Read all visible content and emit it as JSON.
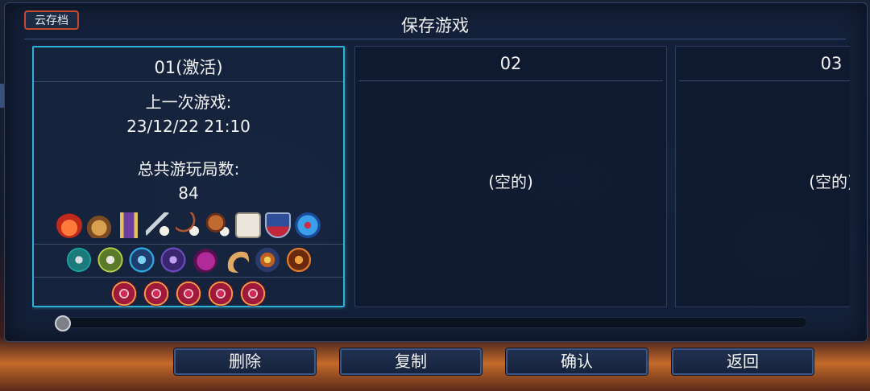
{
  "header": {
    "cloud_save_label": "云存档",
    "title": "保存游戏"
  },
  "slots": [
    {
      "title": "01(激活)",
      "active": true,
      "last_played_label": "上一次游戏:",
      "last_played_value": "23/12/22 21:10",
      "total_runs_label": "总共游玩局数:",
      "total_runs_value": "84",
      "icon_rows": [
        [
          "fire-flask-icon",
          "gold-pouch-icon",
          "stat-scroll-icon",
          "sword-dice-icon",
          "bow-dice-icon",
          "shield-dice-icon",
          "white-dice-icon",
          "heater-shield-icon",
          "blue-orb-icon"
        ],
        [
          "trophy-rune-icon",
          "wrench-rune-icon",
          "grapple-rune-icon",
          "teleport-rune-icon",
          "purple-blob-icon",
          "horn-icon",
          "spider-rune-icon",
          "orange-rune-icon"
        ],
        [
          "boss-cell-icon",
          "boss-cell-icon",
          "boss-cell-icon",
          "boss-cell-icon",
          "boss-cell-icon"
        ]
      ]
    },
    {
      "title": "02",
      "active": false,
      "empty_label": "(空的)"
    },
    {
      "title": "03",
      "active": false,
      "empty_label": "(空的)"
    }
  ],
  "buttons": {
    "delete": "删除",
    "copy": "复制",
    "confirm": "确认",
    "back": "返回"
  },
  "scroll_progress": 0
}
